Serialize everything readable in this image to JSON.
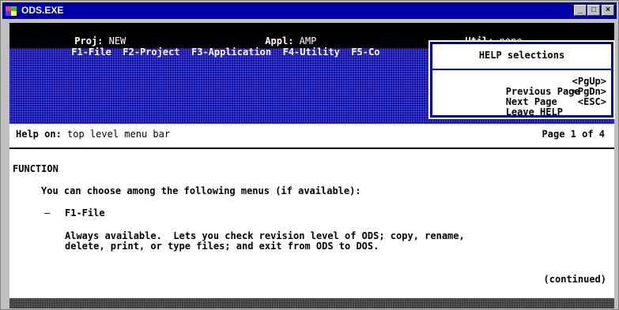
{
  "window": {
    "title": "ODS.EXE",
    "minimize_label": "_",
    "maximize_label": "□",
    "close_label": "×"
  },
  "status": {
    "proj_label": "Proj:",
    "proj_value": "NEW",
    "appl_label": "Appl:",
    "appl_value": "AMP",
    "util_label": "Util:",
    "util_value": "none"
  },
  "menu": {
    "f1": "F1-File",
    "f2": "F2-Project",
    "f3": "F3-Application",
    "f4": "F4-Utility",
    "f5": "F5-Co"
  },
  "help_popup": {
    "title": "HELP selections",
    "items": [
      {
        "label": "Previous Page",
        "key": "<PgUp>"
      },
      {
        "label": "Next Page",
        "key": "<PgDn>"
      },
      {
        "label": "Leave HELP",
        "key": "<ESC>"
      }
    ]
  },
  "content": {
    "help_on_label": "Help on:",
    "help_topic": "top level menu bar",
    "page_indicator": "Page 1 of 4",
    "section": "FUNCTION",
    "intro": "You can choose among the following menus (if available):",
    "bullet_dash": "—",
    "bullet_item": "F1-File",
    "desc_line1": "Always available.  Lets you check revision level of ODS; copy, rename,",
    "desc_line2": "delete, print, or type files; and exit from ODS to DOS.",
    "continued": "(continued)"
  }
}
